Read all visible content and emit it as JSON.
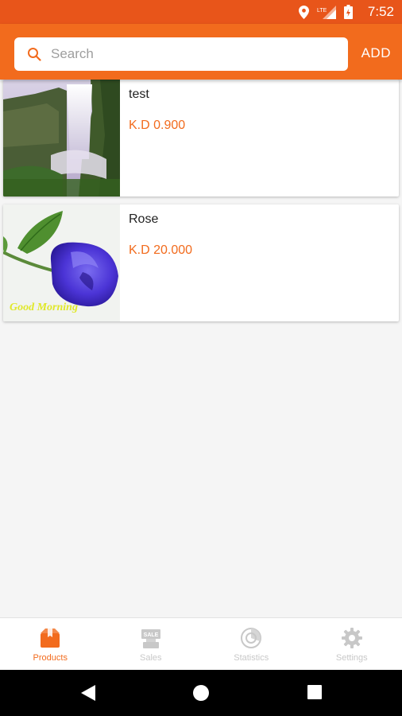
{
  "status_bar": {
    "time": "7:52",
    "network": "LTE"
  },
  "header": {
    "search_placeholder": "Search",
    "add_label": "ADD"
  },
  "products": [
    {
      "name": "test",
      "price": "K.D 0.900"
    },
    {
      "name": "Rose",
      "price": "K.D 20.000",
      "image_caption": "Good Morning"
    }
  ],
  "bottom_nav": {
    "items": [
      {
        "label": "Products",
        "icon": "products-icon",
        "active": true
      },
      {
        "label": "Sales",
        "icon": "sales-icon",
        "active": false
      },
      {
        "label": "Statistics",
        "icon": "statistics-icon",
        "active": false
      },
      {
        "label": "Settings",
        "icon": "settings-icon",
        "active": false
      }
    ]
  },
  "colors": {
    "accent": "#f26b1d",
    "status_bar": "#e8551a",
    "inactive": "#c8c8c8"
  }
}
